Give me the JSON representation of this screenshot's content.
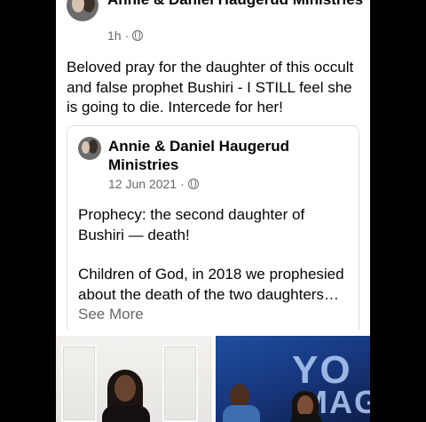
{
  "post": {
    "author": "Annie & Daniel Haugerud Ministries",
    "time": "1h",
    "privacy_icon": "globe-icon",
    "text": "Beloved pray for the daughter of this occult and false prophet Bushiri - I STILL feel she is going to die. Intercede for her!"
  },
  "shared_post": {
    "author": "Annie & Daniel Haugerud Ministries",
    "date": "12 Jun 2021",
    "privacy_icon": "globe-icon",
    "paragraph1": "Prophecy: the second daughter of Bushiri — death!",
    "paragraph2": "Children of God, in 2018 we prophesied about the death of the two daughters…",
    "see_more": "See More"
  },
  "photos": {
    "photo2_text_line1": "YO",
    "photo2_text_line2": "MAG"
  },
  "colors": {
    "background": "#000000",
    "card": "#ffffff",
    "text": "#050505",
    "secondary_text": "#65676b",
    "border": "#dadde1"
  }
}
